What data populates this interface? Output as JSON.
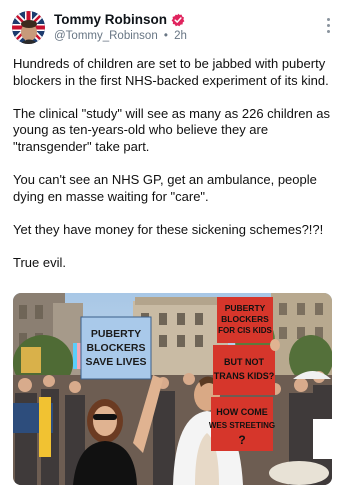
{
  "author": {
    "name": "Tommy Robinson",
    "handle": "@Tommy_Robinson",
    "separator": "•",
    "time": "2h",
    "verified_color": "#e0245e"
  },
  "post": {
    "paragraphs": [
      "Hundreds of children are set to be jabbed with puberty blockers in the first NHS-backed experiment of its kind.",
      "The clinical \"study\" will see as many as 226 children as young as ten-years-old who believe they are \"transgender\" take part.",
      "You can't see an NHS GP, get an ambulance, people dying en masse waiting for \"care\".",
      "Yet they have money for these sickening schemes?!?!",
      "True evil."
    ]
  },
  "media": {
    "signs": {
      "blue_sign": [
        "PUBERTY",
        "BLOCKERS",
        "SAVE LIVES"
      ],
      "red_top": [
        "PUBERTY",
        "BLOCKERS",
        "FOR CIS KIDS"
      ],
      "red_middle": [
        "BUT NOT",
        "TRANS KIDS?"
      ],
      "red_bottom": [
        "HOW COME",
        "WES STREETING",
        "?"
      ]
    }
  },
  "icons": {
    "verified": "verified-badge-icon",
    "more": "more-vertical-icon"
  }
}
